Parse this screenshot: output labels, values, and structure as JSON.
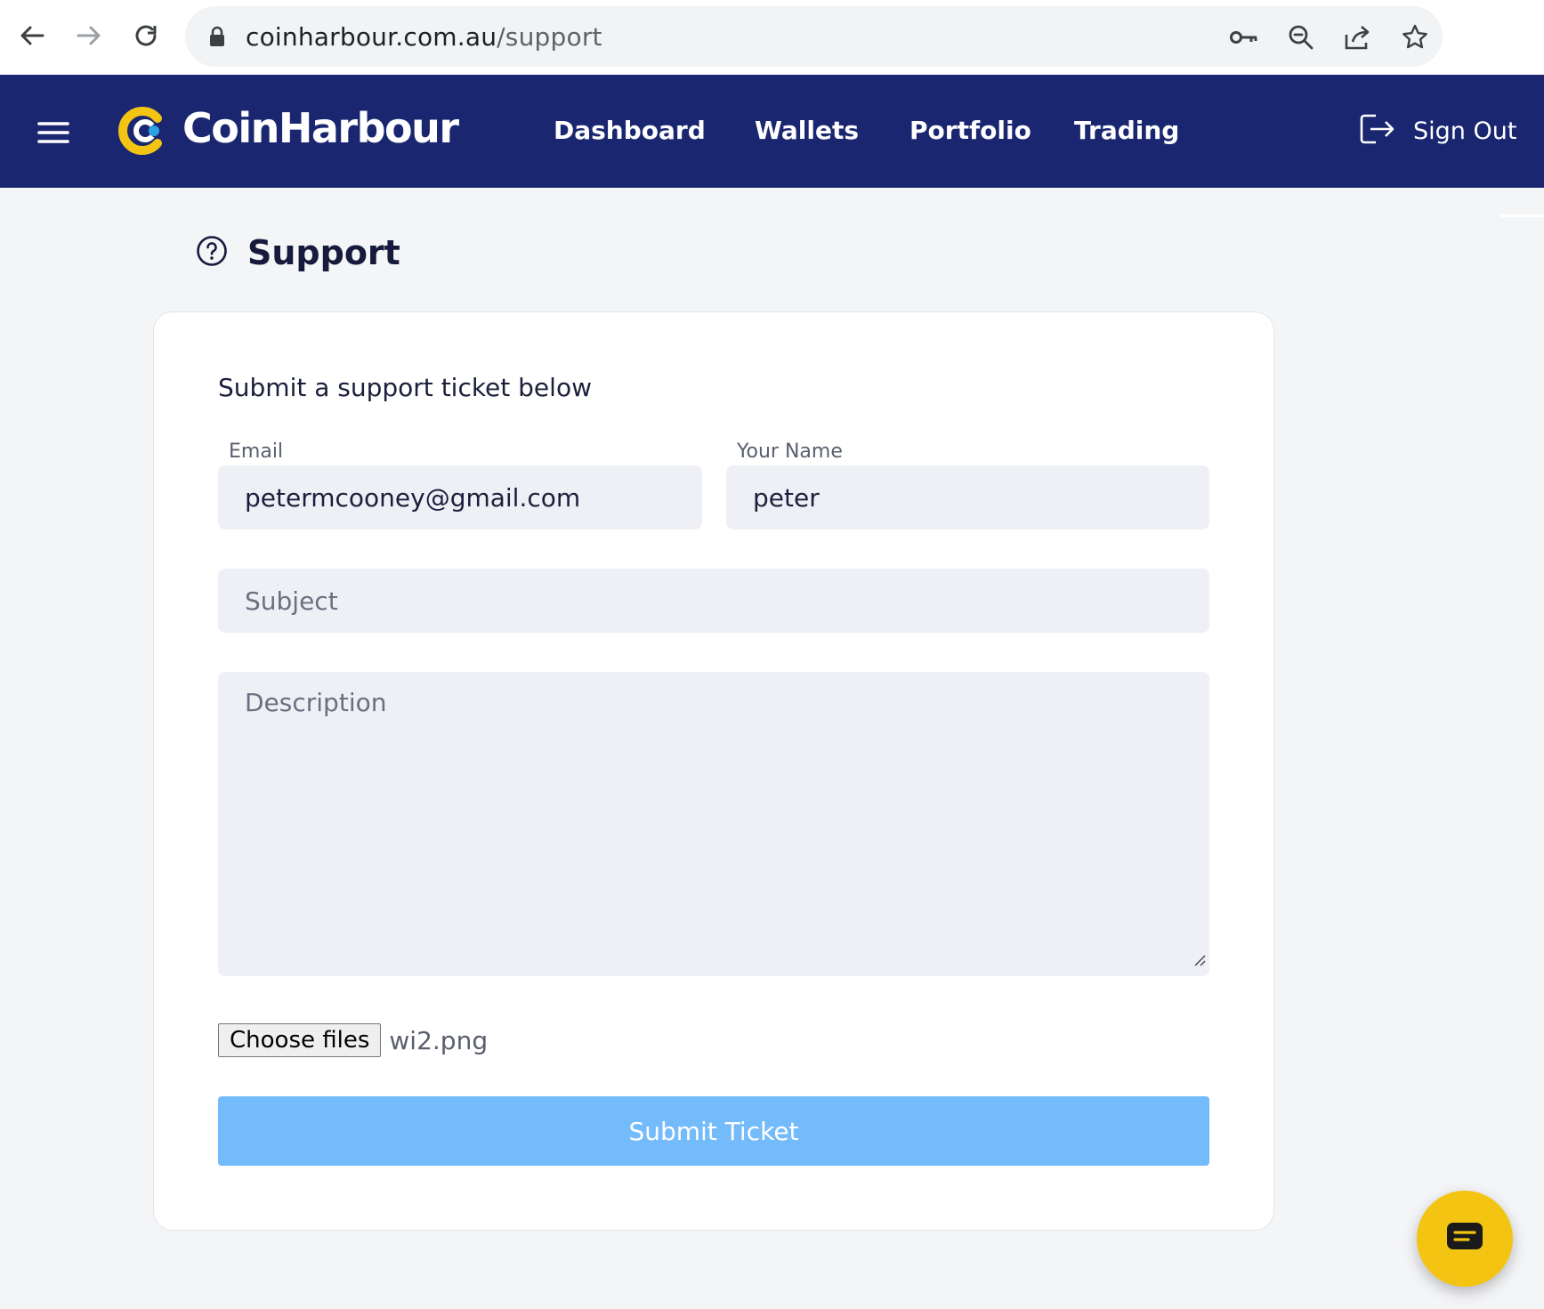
{
  "browser": {
    "url_host": "coinharbour.com.au",
    "url_path": "/support"
  },
  "header": {
    "brand": "CoinHarbour",
    "nav": [
      {
        "label": "Dashboard"
      },
      {
        "label": "Wallets"
      },
      {
        "label": "Portfolio"
      },
      {
        "label": "Trading"
      }
    ],
    "sign_out": "Sign Out"
  },
  "page": {
    "title": "Support"
  },
  "form": {
    "heading": "Submit a support ticket below",
    "email_label": "Email",
    "email_value": "petermcooney@gmail.com",
    "name_label": "Your Name",
    "name_value": "peter",
    "subject_placeholder": "Subject",
    "description_placeholder": "Description",
    "file_button": "Choose files",
    "file_name": "wi2.png",
    "submit_label": "Submit Ticket"
  },
  "colors": {
    "header_bg": "#1a2770",
    "logo_accent": "#f3c512",
    "submit_bg": "#74bbfb",
    "field_bg": "#eef0f6"
  },
  "icons": {
    "back": "back-arrow-icon",
    "forward": "forward-arrow-icon",
    "reload": "reload-icon",
    "lock": "lock-icon",
    "key": "key-icon",
    "zoom": "zoom-out-icon",
    "share": "share-icon",
    "bookmark": "star-icon",
    "menu": "hamburger-icon",
    "logout": "logout-icon",
    "help": "question-circle-icon",
    "chat": "chat-icon"
  }
}
